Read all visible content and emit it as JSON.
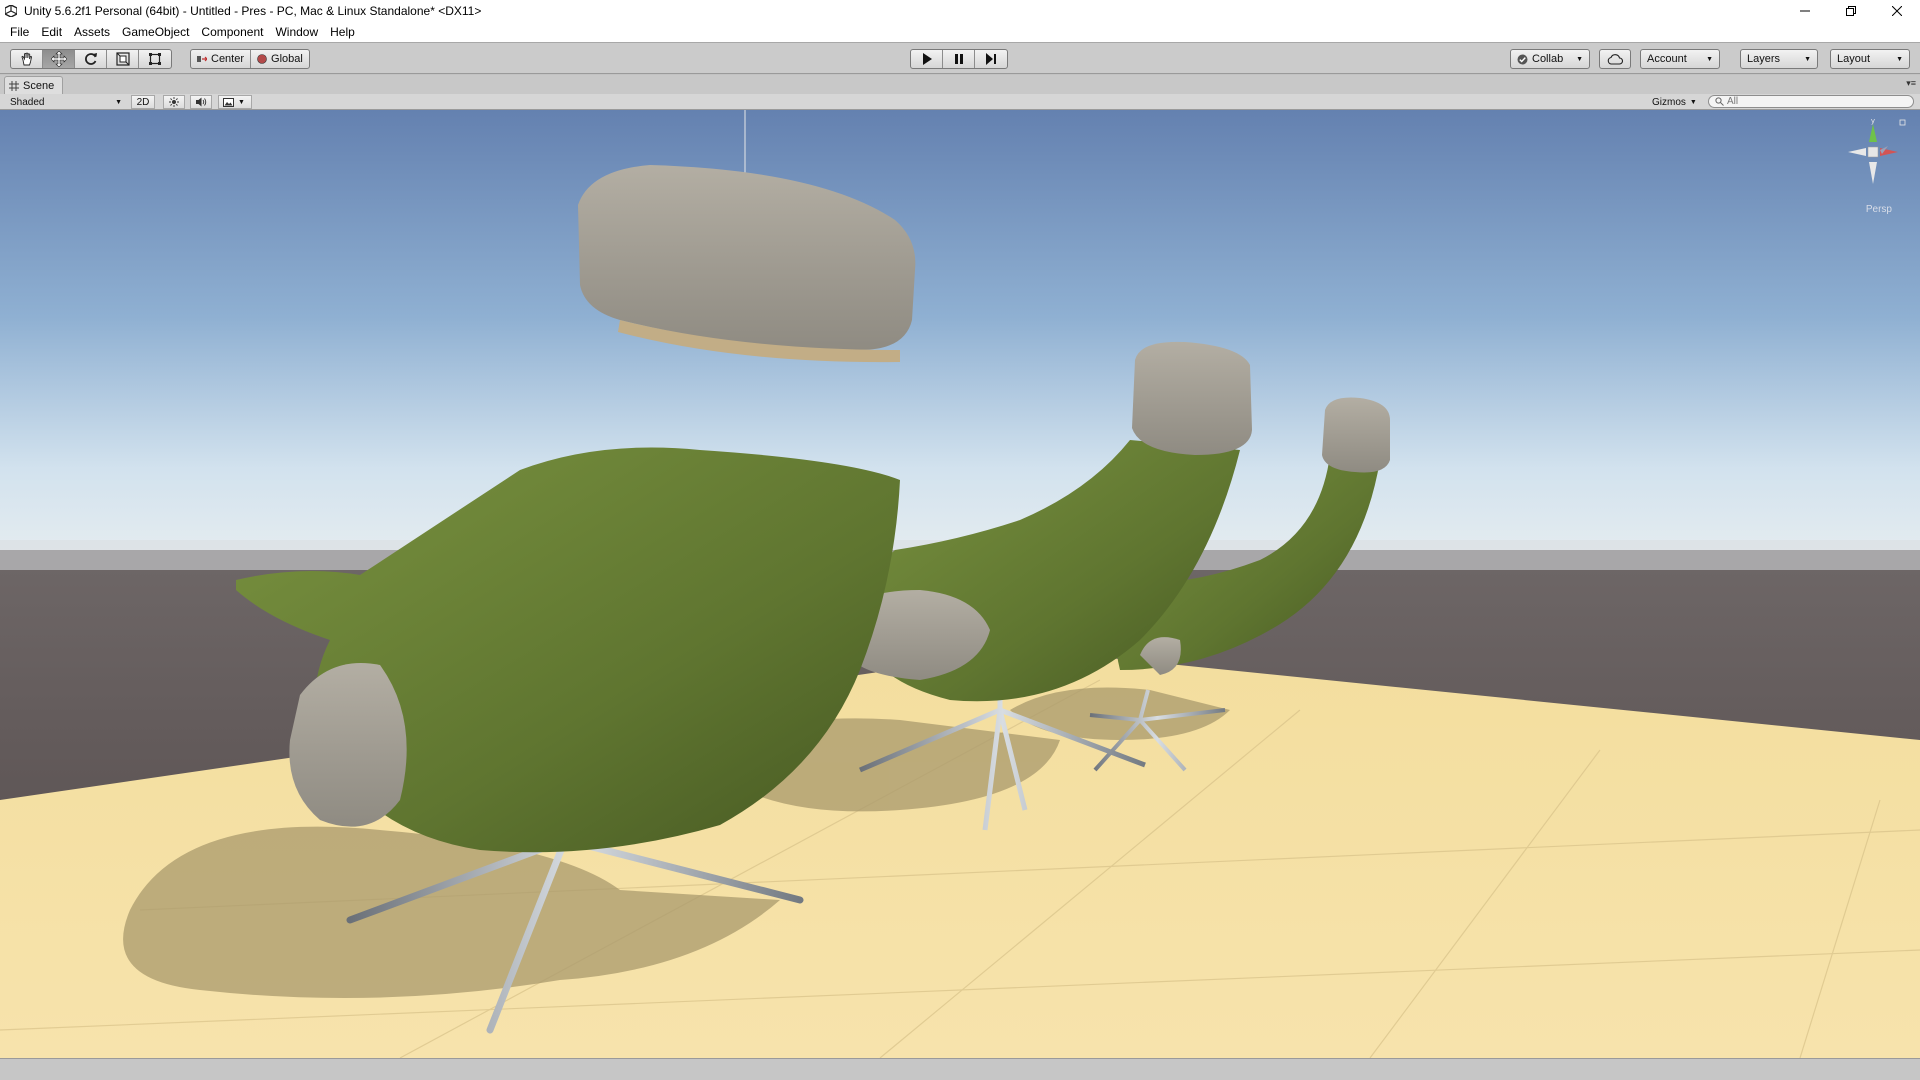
{
  "window": {
    "title": "Unity 5.6.2f1 Personal (64bit) - Untitled - Pres - PC, Mac & Linux Standalone* <DX11>"
  },
  "menu": [
    "File",
    "Edit",
    "Assets",
    "GameObject",
    "Component",
    "Window",
    "Help"
  ],
  "toolbar": {
    "tools": [
      "hand-tool-icon",
      "move-tool-icon",
      "rotate-tool-icon",
      "scale-tool-icon",
      "rect-tool-icon"
    ],
    "active_tool": "move-tool-icon",
    "pivot_mode": "Center",
    "pivot_rotation": "Global",
    "collab_label": "Collab",
    "account_label": "Account",
    "layers_label": "Layers",
    "layout_label": "Layout"
  },
  "scene": {
    "tab_label": "Scene",
    "draw_mode": "Shaded",
    "mode_2d": "2D",
    "gizmos_label": "Gizmos",
    "search_placeholder": "All",
    "projection": "Persp"
  },
  "colors": {
    "sky_top": "#6b87b3",
    "sky_horizon": "#cfe0ec",
    "floor": "#f5dfa0",
    "ground": "#595150",
    "chair_green": "#667d36",
    "cushion_gray": "#a8a49a"
  }
}
